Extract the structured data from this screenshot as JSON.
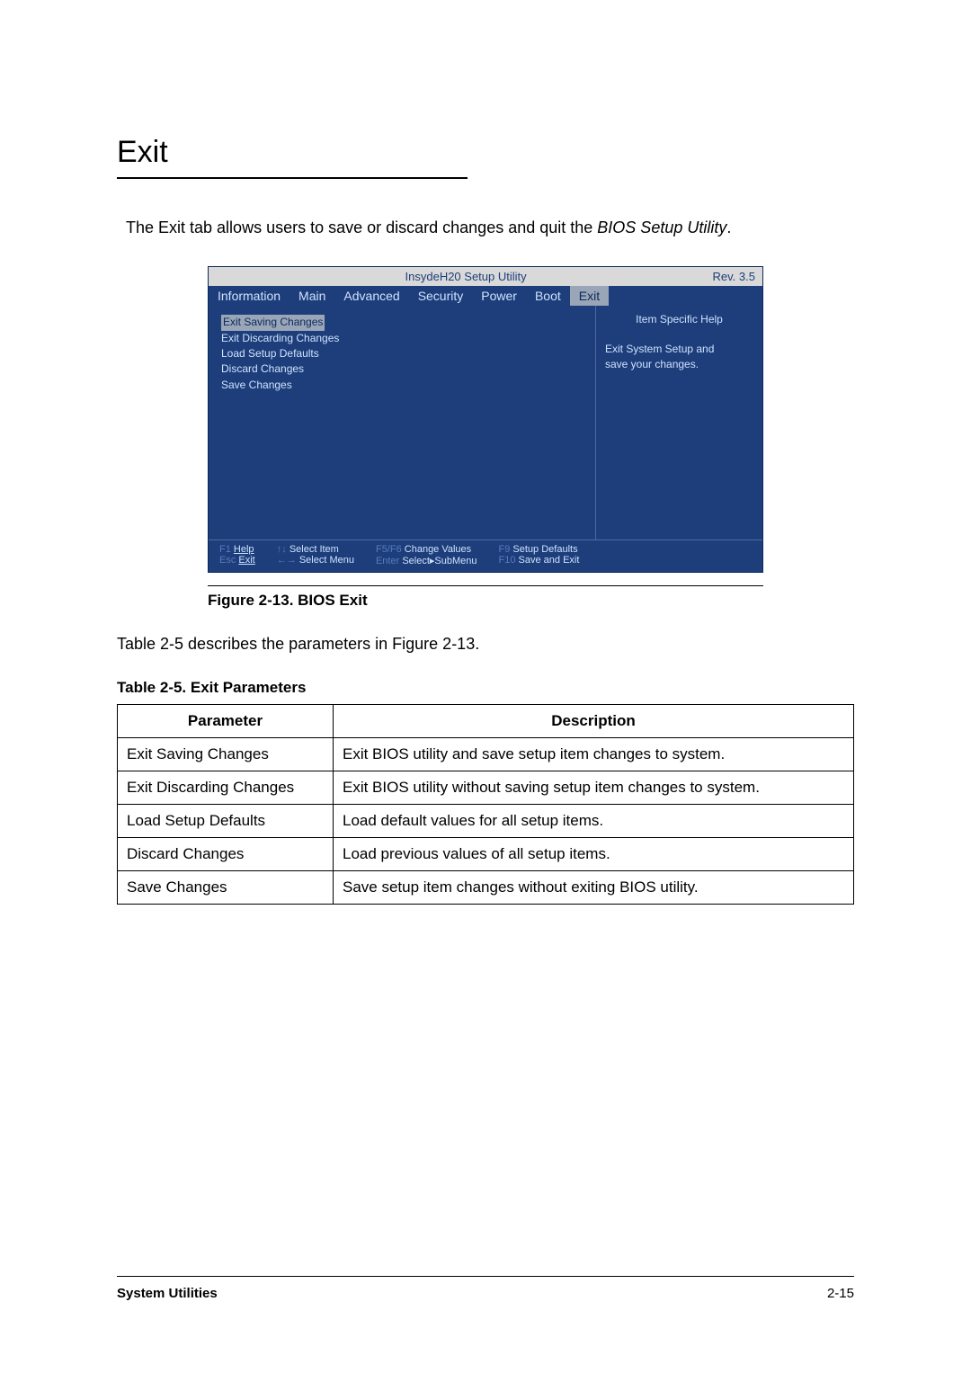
{
  "heading": "Exit",
  "intro": {
    "text": "The Exit tab allows users to save or discard changes and quit the ",
    "italic": "BIOS Setup Utility",
    "suffix": "."
  },
  "bios": {
    "title": "InsydeH20 Setup Utility",
    "rev": "Rev. 3.5",
    "tabs": [
      "Information",
      "Main",
      "Advanced",
      "Security",
      "Power",
      "Boot",
      "Exit"
    ],
    "activeTab": "Exit",
    "menu": [
      "Exit Saving Changes",
      "Exit Discarding Changes",
      "Load Setup Defaults",
      "Discard Changes",
      "Save Changes"
    ],
    "help": {
      "header": "Item Specific Help",
      "text1": "Exit System Setup and",
      "text2": "save your changes."
    },
    "footer": {
      "c1a": {
        "key": "F1",
        "lbl": "Help"
      },
      "c1b": {
        "key": "Esc",
        "lbl": "Exit"
      },
      "c2a": {
        "key": "↑↓",
        "lbl": "Select Item"
      },
      "c2b": {
        "key": "←→",
        "lbl": "Select Menu"
      },
      "c3a": {
        "key": "F5/F6",
        "lbl": "Change Values"
      },
      "c3b": {
        "key": "Enter",
        "lbl": "Select▸SubMenu"
      },
      "c4a": {
        "key": "F9",
        "lbl": "Setup Defaults"
      },
      "c4b": {
        "key": "F10",
        "lbl": "Save and Exit"
      }
    }
  },
  "figcap": "Figure 2-13.  BIOS Exit",
  "bodytext": "Table 2-5  describes the parameters in Figure 2-13.",
  "tabcap": "Table 2-5.  Exit Parameters",
  "table": {
    "h1": "Parameter",
    "h2": "Description",
    "rows": [
      {
        "p": "Exit Saving Changes",
        "d": "Exit BIOS utility and save setup item changes to system."
      },
      {
        "p": "Exit Discarding Changes",
        "d": "Exit BIOS utility without saving setup item changes to system."
      },
      {
        "p": "Load Setup Defaults",
        "d": "Load default values for all setup items."
      },
      {
        "p": "Discard Changes",
        "d": "Load previous values of all setup items."
      },
      {
        "p": "Save Changes",
        "d": "Save setup item changes without exiting BIOS utility."
      }
    ]
  },
  "footer": {
    "left": "System Utilities",
    "right": "2-15"
  }
}
